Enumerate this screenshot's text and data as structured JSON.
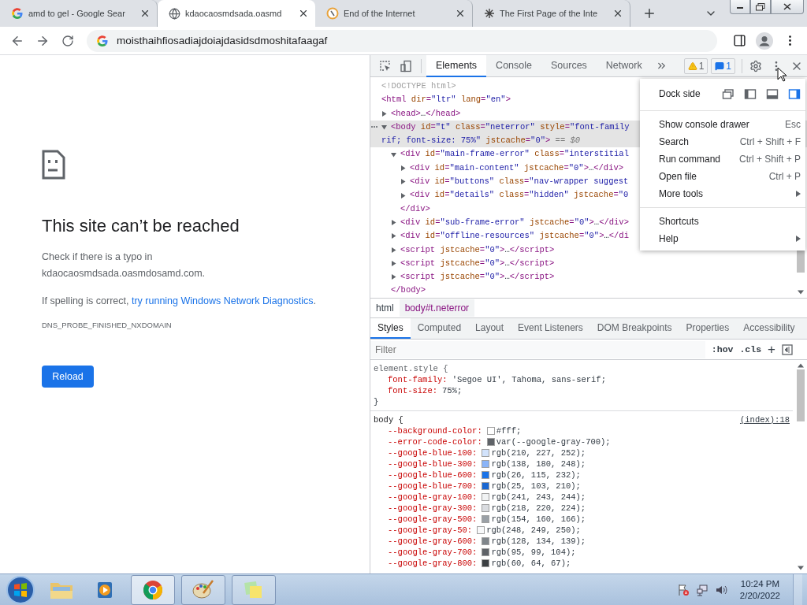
{
  "browser": {
    "tabs": [
      {
        "title": "amd to gel - Google Sear",
        "kind": "google",
        "selected": false
      },
      {
        "title": "kdaocaosmdsada.oasmd",
        "kind": "globe",
        "selected": true
      },
      {
        "title": "End of the Internet",
        "kind": "compass",
        "selected": false
      },
      {
        "title": "The First Page of the Inte",
        "kind": "spark",
        "selected": false
      }
    ],
    "address": "moisthaihfiosadiajdoiajdasidsdmoshitafaagaf"
  },
  "page": {
    "title": "This site can’t be reached",
    "check_text": "Check if there is a typo in",
    "domain": "kdaocaosmdsada.oasmdosamd.com.",
    "hint_text": "If spelling is correct,",
    "hint_link": "try running Windows Network Diagnostics",
    "hint_end": ".",
    "error_code": "DNS_PROBE_FINISHED_NXDOMAIN",
    "button": "Reload"
  },
  "devtools": {
    "tabs": [
      {
        "label": "Elements",
        "selected": true
      },
      {
        "label": "Console",
        "selected": false
      },
      {
        "label": "Sources",
        "selected": false
      },
      {
        "label": "Network",
        "selected": false
      }
    ],
    "warnings": "1",
    "messages": "1",
    "dom": [
      {
        "text": "<!DOCTYPE html>",
        "kind": "doctype"
      },
      {
        "text": "<html dir=\"ltr\" lang=\"en\">",
        "children": [
          {
            "text": "<head>…</head>",
            "expanded": false
          },
          {
            "text": "<body id=\"t\" class=\"neterror\" style=\"font-family",
            "wrap": "rif; font-size: 75%\" jstcache=\"0\">",
            "marker": "== $0",
            "expanded": true,
            "selected": true,
            "close": "</body>",
            "children": [
              {
                "text": "<div id=\"main-frame-error\" class=\"interstitial",
                "expanded": true,
                "close": "</div>",
                "children": [
                  {
                    "text": "<div id=\"main-content\" jstcache=\"0\">…</div>",
                    "expanded": false
                  },
                  {
                    "text": "<div id=\"buttons\" class=\"nav-wrapper suggest",
                    "expanded": false
                  },
                  {
                    "text": "<div id=\"details\" class=\"hidden\" jstcache=\"0",
                    "expanded": false
                  }
                ]
              },
              {
                "text": "<div id=\"sub-frame-error\" jstcache=\"0\">…</div>",
                "expanded": false
              },
              {
                "text": "<div id=\"offline-resources\" jstcache=\"0\">…</di",
                "expanded": false
              },
              {
                "text": "<script jstcache=\"0\">…</script>",
                "expanded": false
              },
              {
                "text": "<script jstcache=\"0\">…</script>",
                "expanded": false
              },
              {
                "text": "<script jstcache=\"0\">…</script>",
                "expanded": false
              }
            ]
          }
        ]
      }
    ],
    "menu": {
      "dock_label": "Dock side",
      "dock_options": [
        {
          "kind": "undock",
          "selected": false
        },
        {
          "kind": "left",
          "selected": false
        },
        {
          "kind": "bottom",
          "selected": false
        },
        {
          "kind": "right",
          "selected": true
        }
      ],
      "groups": [
        [
          {
            "label": "Show console drawer",
            "shortcut": "Esc"
          },
          {
            "label": "Search",
            "shortcut": "Ctrl + Shift + F"
          },
          {
            "label": "Run command",
            "shortcut": "Ctrl + Shift + P"
          },
          {
            "label": "Open file",
            "shortcut": "Ctrl + P"
          },
          {
            "label": "More tools",
            "submenu": true
          }
        ],
        [
          {
            "label": "Shortcuts"
          },
          {
            "label": "Help",
            "submenu": true
          }
        ]
      ]
    },
    "breadcrumbs": [
      {
        "label": "html",
        "selected": false
      },
      {
        "label": "body#t.neterror",
        "selected": true
      }
    ],
    "panel_tabs": [
      {
        "label": "Styles",
        "selected": true
      },
      {
        "label": "Computed",
        "selected": false
      },
      {
        "label": "Layout",
        "selected": false
      },
      {
        "label": "Event Listeners",
        "selected": false
      },
      {
        "label": "DOM Breakpoints",
        "selected": false
      },
      {
        "label": "Properties",
        "selected": false
      },
      {
        "label": "Accessibility",
        "selected": false
      }
    ],
    "filter": {
      "placeholder": "Filter",
      "hov": ":hov",
      "cls": ".cls",
      "add": "+"
    },
    "rules": [
      {
        "selector": "element.style {",
        "close": "}",
        "properties": [
          {
            "name": "font-family:",
            "value": "'Segoe UI', Tahoma, sans-serif;"
          },
          {
            "name": "font-size:",
            "value": "75%;"
          }
        ]
      },
      {
        "selector": "body {",
        "source": "(index):18",
        "properties": [
          {
            "name": "--background-color:",
            "value": "#fff;",
            "color": "#ffffff"
          },
          {
            "name": "--error-code-color:",
            "value": "var(--google-gray-700);",
            "color": "#5f6368"
          },
          {
            "name": "--google-blue-100:",
            "value": "rgb(210, 227, 252);",
            "color": "#d2e3fc"
          },
          {
            "name": "--google-blue-300:",
            "value": "rgb(138, 180, 248);",
            "color": "#8ab4f8"
          },
          {
            "name": "--google-blue-600:",
            "value": "rgb(26, 115, 232);",
            "color": "#1a73e8"
          },
          {
            "name": "--google-blue-700:",
            "value": "rgb(25, 103, 210);",
            "color": "#1967d2"
          },
          {
            "name": "--google-gray-100:",
            "value": "rgb(241, 243, 244);",
            "color": "#f1f3f4"
          },
          {
            "name": "--google-gray-300:",
            "value": "rgb(218, 220, 224);",
            "color": "#dadce0"
          },
          {
            "name": "--google-gray-500:",
            "value": "rgb(154, 160, 166);",
            "color": "#9aa0a6"
          },
          {
            "name": "--google-gray-50:",
            "value": "rgb(248, 249, 250);",
            "color": "#f8f9fa"
          },
          {
            "name": "--google-gray-600:",
            "value": "rgb(128, 134, 139);",
            "color": "#80868b"
          },
          {
            "name": "--google-gray-700:",
            "value": "rgb(95, 99, 104);",
            "color": "#5f6368"
          },
          {
            "name": "--google-gray-800:",
            "value": "rgb(60, 64, 67);",
            "color": "#3c4043"
          }
        ]
      }
    ]
  },
  "taskbar": {
    "apps": [
      {
        "kind": "explorer",
        "running": false,
        "selected": false
      },
      {
        "kind": "media",
        "running": false,
        "selected": false
      },
      {
        "kind": "chrome",
        "running": true,
        "selected": true
      },
      {
        "kind": "paint",
        "running": true,
        "selected": false
      },
      {
        "kind": "notes",
        "running": true,
        "selected": false
      }
    ],
    "time": "10:24 PM",
    "date": "2/20/2022"
  }
}
